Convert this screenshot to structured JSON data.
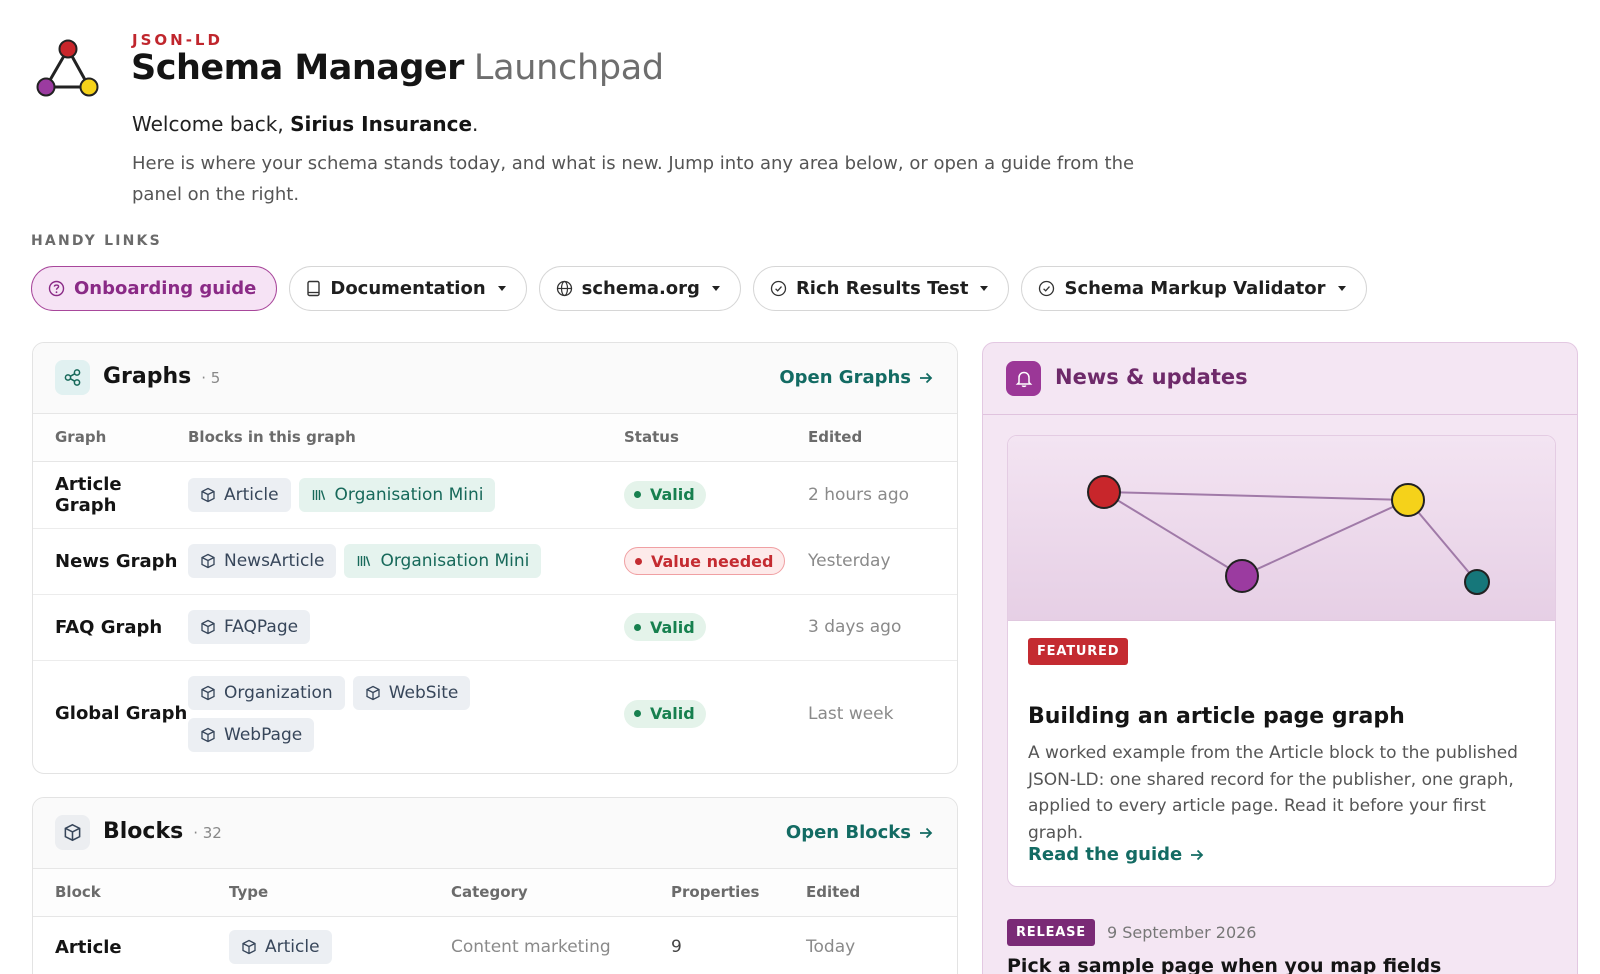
{
  "header": {
    "eyebrow": "JSON-LD",
    "title": "Schema Manager",
    "subtitle": "Launchpad",
    "welcome_prefix": "Welcome back, ",
    "welcome_name": "Sirius Insurance",
    "welcome_suffix": ".",
    "intro": "Here is where your schema stands today, and what is new. Jump into any area below, or open a guide from the panel on the right."
  },
  "handy_links": {
    "label": "HANDY LINKS",
    "items": [
      {
        "label": "Onboarding guide",
        "icon": "question-circle-icon",
        "dropdown": false
      },
      {
        "label": "Documentation",
        "icon": "book-icon",
        "dropdown": true
      },
      {
        "label": "schema.org",
        "icon": "globe-icon",
        "dropdown": true
      },
      {
        "label": "Rich Results Test",
        "icon": "check-circle-icon",
        "dropdown": true
      },
      {
        "label": "Schema Markup Validator",
        "icon": "check-circle-icon",
        "dropdown": true
      }
    ]
  },
  "graphs": {
    "title": "Graphs",
    "count": "· 5",
    "open_link": "Open Graphs",
    "columns": [
      "Graph",
      "Blocks in this graph",
      "Status",
      "Edited"
    ],
    "rows": [
      {
        "name": "Article Graph",
        "blocks": [
          {
            "label": "Article",
            "kind": "block"
          },
          {
            "label": "Organisation Mini",
            "kind": "library"
          }
        ],
        "status": "Valid",
        "status_kind": "valid",
        "edited": "2 hours ago"
      },
      {
        "name": "News Graph",
        "blocks": [
          {
            "label": "NewsArticle",
            "kind": "block"
          },
          {
            "label": "Organisation Mini",
            "kind": "library"
          }
        ],
        "status": "Value needed",
        "status_kind": "needed",
        "edited": "Yesterday"
      },
      {
        "name": "FAQ Graph",
        "blocks": [
          {
            "label": "FAQPage",
            "kind": "block"
          }
        ],
        "status": "Valid",
        "status_kind": "valid",
        "edited": "3 days ago"
      },
      {
        "name": "Global Graph",
        "blocks": [
          {
            "label": "Organization",
            "kind": "block"
          },
          {
            "label": "WebSite",
            "kind": "block"
          },
          {
            "label": "WebPage",
            "kind": "block"
          }
        ],
        "status": "Valid",
        "status_kind": "valid",
        "edited": "Last week"
      }
    ]
  },
  "blocks": {
    "title": "Blocks",
    "count": "· 32",
    "open_link": "Open Blocks",
    "columns": [
      "Block",
      "Type",
      "Category",
      "Properties",
      "Edited"
    ],
    "rows": [
      {
        "name": "Article",
        "type": "Article",
        "category": "Content marketing",
        "properties": "9",
        "edited": "Today"
      }
    ]
  },
  "news": {
    "title": "News & updates",
    "featured": {
      "badge": "FEATURED",
      "title": "Building an article page graph",
      "body": "A worked example from the Article block to the published JSON-LD: one shared record for the publisher, one graph, applied to every article page. Read it before your first graph.",
      "link": "Read the guide"
    },
    "release": {
      "badge": "RELEASE",
      "date": "9 September 2026",
      "title": "Pick a sample page when you map fields"
    }
  },
  "colors": {
    "brand_red": "#c42b31",
    "brand_purple": "#9b3797",
    "link_teal": "#136b63",
    "node_red": "#c8262b",
    "node_purple": "#9b3ba0",
    "node_yellow": "#f5d21a",
    "node_teal": "#16777a"
  }
}
